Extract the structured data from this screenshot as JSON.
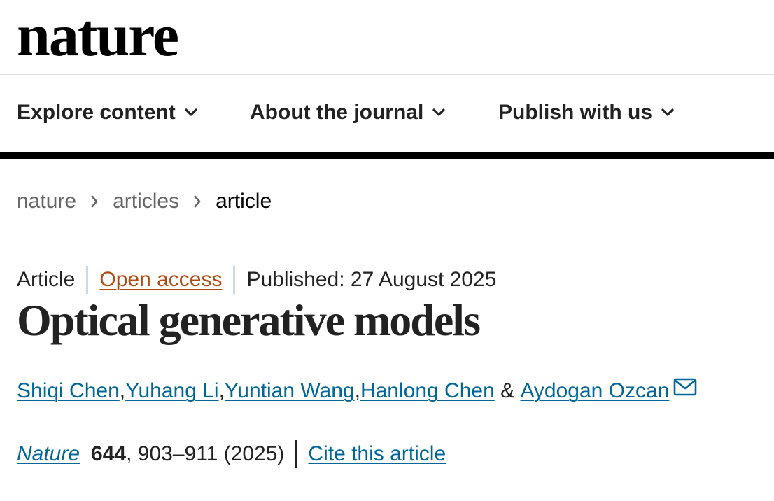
{
  "brand": {
    "logo_text": "nature"
  },
  "nav": {
    "items": [
      {
        "label": "Explore content",
        "icon": "chevron-down-icon"
      },
      {
        "label": "About the journal",
        "icon": "chevron-down-icon"
      },
      {
        "label": "Publish with us",
        "icon": "chevron-down-icon"
      }
    ]
  },
  "breadcrumb": {
    "items": [
      {
        "label": "nature",
        "link": true
      },
      {
        "label": "articles",
        "link": true
      },
      {
        "label": "article",
        "link": false
      }
    ],
    "separator_icon": "chevron-right-icon"
  },
  "article": {
    "type": "Article",
    "access": "Open access",
    "published": "Published: 27 August 2025",
    "title": "Optical generative models",
    "authors": [
      {
        "name": "Shiqi Chen"
      },
      {
        "name": "Yuhang Li"
      },
      {
        "name": "Yuntian Wang"
      },
      {
        "name": "Hanlong Chen"
      },
      {
        "name": "Aydogan Ozcan",
        "icon": "mail-icon"
      }
    ],
    "author_separators": [
      ", ",
      ", ",
      ", ",
      " & "
    ],
    "citation": {
      "journal": "Nature",
      "volume": "644",
      "pages": ", 903–911 (2025)",
      "cite_label": "Cite this article"
    }
  },
  "colors": {
    "link": "#006699",
    "open_access": "#b14b13",
    "text": "#222222",
    "breadcrumb_link": "#666666",
    "nav_rule": "#000000",
    "meta_separator": "#cfd8e3"
  }
}
